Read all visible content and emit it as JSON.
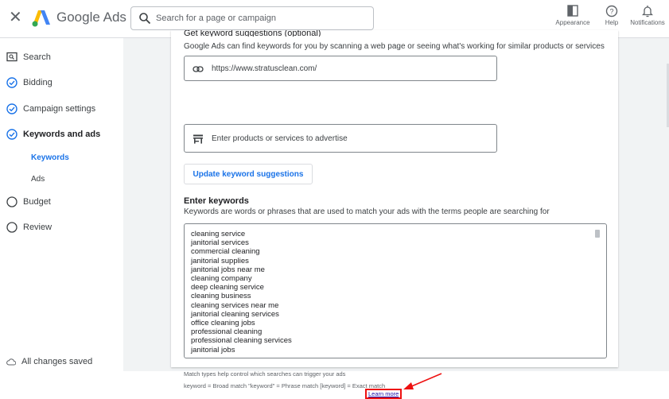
{
  "topbar": {
    "brand": "Google Ads",
    "search_placeholder": "Search for a page or campaign",
    "tools": [
      {
        "icon": "appearance-icon",
        "label": "Appearance"
      },
      {
        "icon": "help-icon",
        "label": "Help"
      },
      {
        "icon": "bell-icon",
        "label": "Notifications"
      }
    ]
  },
  "sidebar": {
    "items": [
      {
        "label": "Search",
        "icon": "campaign-type-icon"
      },
      {
        "label": "Bidding",
        "icon": "check-circle-icon"
      },
      {
        "label": "Campaign settings",
        "icon": "check-circle-icon"
      },
      {
        "label": "Keywords and ads",
        "icon": "check-circle-icon"
      },
      {
        "label": "Budget",
        "icon": "empty-circle-icon"
      },
      {
        "label": "Review",
        "icon": "empty-circle-icon"
      }
    ],
    "sub_items": [
      {
        "label": "Keywords",
        "active": true
      },
      {
        "label": "Ads",
        "active": false
      }
    ],
    "status": "All changes saved"
  },
  "main": {
    "cut_heading": "Get keyword suggestions (optional)",
    "suggest_desc": "Google Ads can find keywords for you by scanning a web page or seeing what's working for similar products or services",
    "url_value": "https://www.stratusclean.com/",
    "products_placeholder": "Enter products or services to advertise",
    "update_button": "Update keyword suggestions",
    "enter_title": "Enter keywords",
    "enter_desc": "Keywords are words or phrases that are used to match your ads with the terms people are searching for",
    "keywords": [
      "cleaning service",
      "janitorial services",
      "commercial cleaning",
      "janitorial supplies",
      "janitorial jobs near me",
      "cleaning company",
      "deep cleaning service",
      "cleaning business",
      "cleaning services near me",
      "janitorial cleaning services",
      "office cleaning jobs",
      "professional cleaning",
      "professional cleaning services",
      "janitorial jobs"
    ],
    "match_hint": "Match types help control which searches can trigger your ads",
    "match_types": "keyword = Broad match  \"keyword\" = Phrase match  [keyword] = Exact match",
    "learn_more": "Learn more"
  },
  "colors": {
    "accent": "#1a73e8",
    "highlight_box": "#ee1111"
  }
}
